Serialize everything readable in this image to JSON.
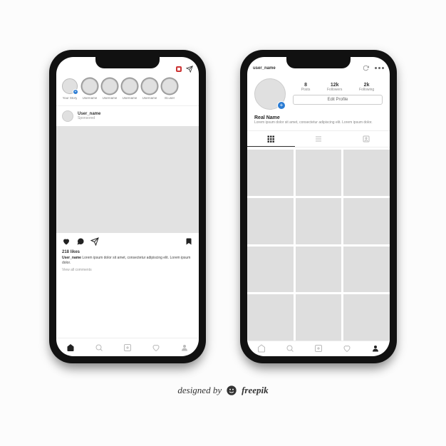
{
  "feed": {
    "stories": [
      {
        "label": "Your Story",
        "has_add_badge": true
      },
      {
        "label": "Username",
        "outlined": true
      },
      {
        "label": "Username",
        "outlined": true
      },
      {
        "label": "Username",
        "outlined": true
      },
      {
        "label": "Username",
        "outlined": true
      },
      {
        "label": "St.user",
        "outlined": true
      }
    ],
    "post": {
      "username": "User_name",
      "sublabel": "Sponsored",
      "likes": "218 likes",
      "caption_user": "User_name",
      "caption_text": "Lorem ipsum dolor sit amet, consectetur adipiscing elit. Lorem ipsum dolor.",
      "view_comments": "View all comments"
    }
  },
  "profile": {
    "header_username": "user_name",
    "stats": [
      {
        "num": "8",
        "label": "Posts"
      },
      {
        "num": "12k",
        "label": "Followers"
      },
      {
        "num": "2k",
        "label": "Following"
      }
    ],
    "edit_profile": "Edit Profile",
    "real_name": "Real Name",
    "bio": "Lorem ipsum dolor sit amet, consectetur adipiscing elit. Lorem ipsum dolor."
  },
  "attribution": {
    "prefix": "designed by",
    "brand": "freepik"
  },
  "colors": {
    "accent": "#2b7cd3"
  }
}
